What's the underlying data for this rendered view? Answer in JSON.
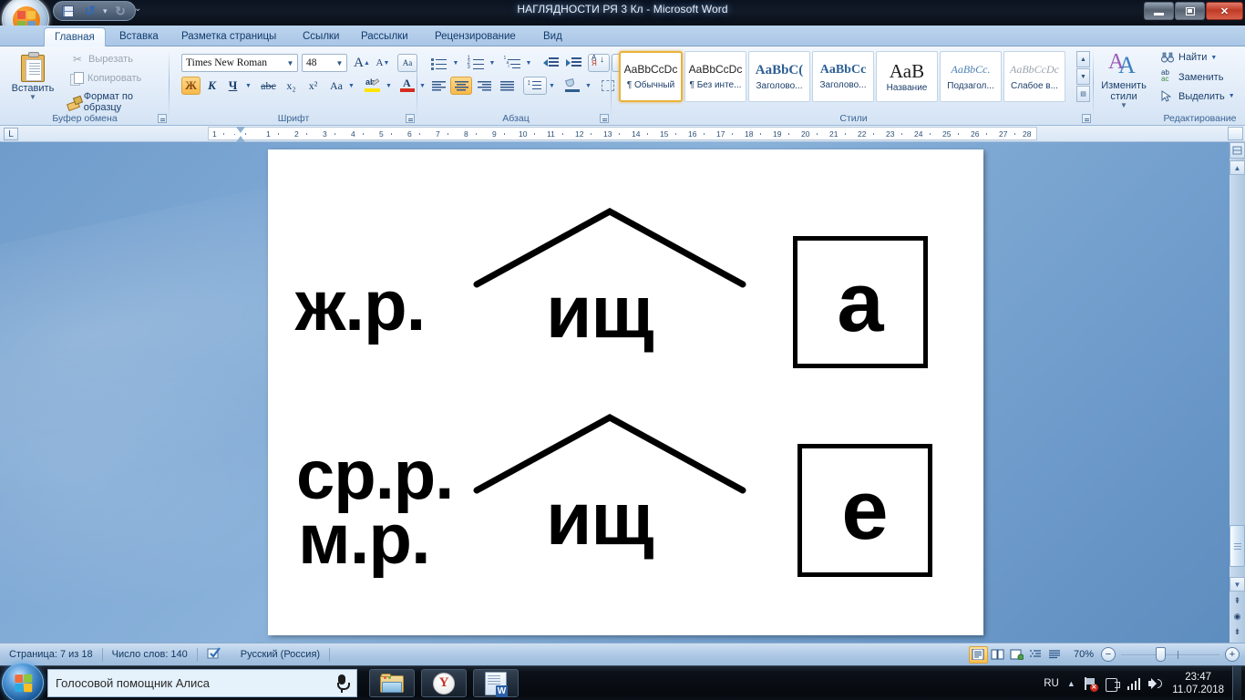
{
  "window": {
    "title": "НАГЛЯДНОСТИ РЯ 3 Кл  -  Microsoft Word",
    "minimize_label": "Свернуть",
    "restore_label": "Свернуть в окно",
    "close_label": "Закрыть",
    "quick_access": [
      "save-icon",
      "undo-icon",
      "redo-icon",
      "customize-qat-icon"
    ]
  },
  "tabs": [
    {
      "label": "Главная",
      "active": true
    },
    {
      "label": "Вставка",
      "active": false
    },
    {
      "label": "Разметка страницы",
      "active": false
    },
    {
      "label": "Ссылки",
      "active": false
    },
    {
      "label": "Рассылки",
      "active": false
    },
    {
      "label": "Рецензирование",
      "active": false
    },
    {
      "label": "Вид",
      "active": false
    }
  ],
  "ribbon": {
    "clipboard": {
      "group_label": "Буфер обмена",
      "paste_label": "Вставить",
      "cut_label": "Вырезать",
      "copy_label": "Копировать",
      "format_painter_label": "Формат по образцу"
    },
    "font": {
      "group_label": "Шрифт",
      "font_name": "Times New Roman",
      "font_size": "48",
      "grow_label": "A",
      "shrink_label": "A",
      "clear_format_label": "Aa",
      "bold_label": "Ж",
      "italic_label": "К",
      "underline_label": "Ч",
      "strike_label": "abc",
      "subscript_label": "x₂",
      "superscript_label": "x²",
      "change_case_label": "Aa",
      "highlight_label": "ab",
      "font_color_label": "A",
      "bold_active": true
    },
    "paragraph": {
      "group_label": "Абзац",
      "bullets_label": "Маркеры",
      "numbering_label": "Нумерация",
      "multilevel_label": "Многоуровневый список",
      "decrease_indent_label": "Уменьшить отступ",
      "increase_indent_label": "Увеличить отступ",
      "sort_label": "Сортировка",
      "marks_label": "¶",
      "align_left_label": "По левому краю",
      "align_center_label": "По центру",
      "align_right_label": "По правому краю",
      "align_justify_label": "По ширине",
      "line_spacing_label": "Междустрочный интервал",
      "shading_label": "Заливка",
      "borders_label": "Границы",
      "align_center_active": true
    },
    "styles": {
      "group_label": "Стили",
      "items": [
        {
          "preview": "AaBbCcDc",
          "name": "¶ Обычный",
          "active": true
        },
        {
          "preview": "AaBbCcDc",
          "name": "¶ Без инте...",
          "active": false
        },
        {
          "preview": "AaBbC(",
          "name": "Заголово...",
          "active": false
        },
        {
          "preview": "AaBbCc",
          "name": "Заголово...",
          "active": false
        },
        {
          "preview": "АаВ",
          "name": "Название",
          "active": false
        },
        {
          "preview": "AaBbCc.",
          "name": "Подзагол...",
          "active": false
        },
        {
          "preview": "AaBbCcDc",
          "name": "Слабое в...",
          "active": false
        }
      ],
      "change_styles_label": "Изменить стили"
    },
    "editing": {
      "group_label": "Редактирование",
      "find_label": "Найти",
      "replace_label": "Заменить",
      "select_label": "Выделить"
    }
  },
  "ruler": {
    "tab_selector_glyph": "L",
    "marks": [
      "1",
      "1",
      "2",
      "3",
      "4",
      "5",
      "6",
      "7",
      "8",
      "9",
      "10",
      "11",
      "12",
      "13",
      "14",
      "15",
      "16",
      "17",
      "18",
      "19",
      "20",
      "21",
      "22",
      "23",
      "24",
      "25",
      "26",
      "27",
      "28"
    ]
  },
  "document": {
    "rows": [
      {
        "gender_labels": [
          "ж.р."
        ],
        "morpheme": "ищ",
        "suffix_mark": "caret-roof",
        "boxed_letter": "а"
      },
      {
        "gender_labels": [
          "ср.р.",
          "м.р."
        ],
        "morpheme": "ищ",
        "suffix_mark": "caret-roof",
        "boxed_letter": "е"
      }
    ]
  },
  "status_bar": {
    "page": "Страница: 7 из 18",
    "word_count": "Число слов: 140",
    "proofing_icon": "spellcheck-icon",
    "language": "Русский (Россия)",
    "zoom_level": "70%",
    "views": [
      {
        "name": "print-layout-view",
        "active": true
      },
      {
        "name": "full-screen-reading-view",
        "active": false
      },
      {
        "name": "web-layout-view",
        "active": false
      },
      {
        "name": "outline-view",
        "active": false
      },
      {
        "name": "draft-view",
        "active": false
      }
    ],
    "zoom_out_label": "−",
    "zoom_in_label": "+"
  },
  "taskbar": {
    "start_label": "Пуск",
    "search_placeholder": "Голосовой помощник Алиса",
    "mic_icon": "microphone-icon",
    "apps": [
      {
        "name": "explorer",
        "icon": "folder-icon"
      },
      {
        "name": "yandex-browser",
        "icon": "yandex-icon",
        "glyph": "Y"
      },
      {
        "name": "microsoft-word",
        "icon": "word-icon",
        "glyph": "W"
      }
    ],
    "tray": {
      "language": "RU",
      "show_hidden_icons": "▲",
      "network_icon": "network-error-icon",
      "action_center_icon": "flag-icon",
      "signal_icon": "signal-bars-icon",
      "volume_icon": "speaker-icon",
      "time": "23:47",
      "date": "11.07.2018"
    }
  },
  "colors": {
    "accent": "#2b5fa8",
    "ribbon_bg": "#e3edf9",
    "desktop": "#7ea8d4",
    "text_dark": "#123b6b"
  }
}
